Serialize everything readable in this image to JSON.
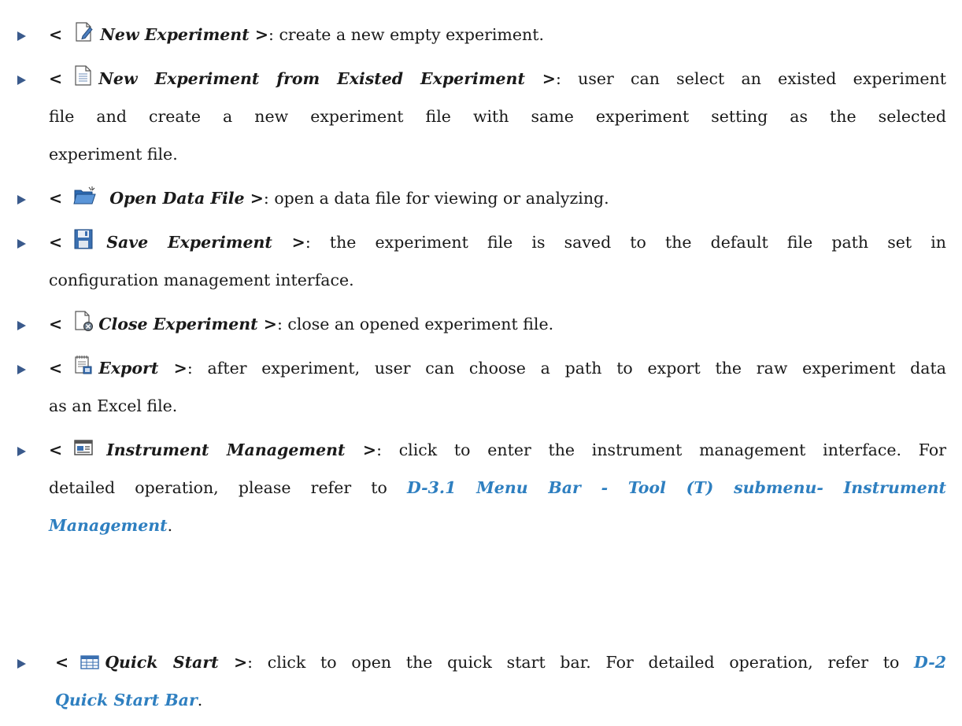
{
  "colors": {
    "bullet": "#3a5a8c",
    "link": "#2e7fc0",
    "text": "#1a1a1a"
  },
  "items": [
    {
      "icon": "new-document-pencil-icon",
      "lt": "<",
      "name": "New Experiment",
      "gt": " >",
      "lines": [
        ": create a new empty experiment."
      ]
    },
    {
      "icon": "document-lines-icon",
      "lt": "<",
      "name": "New Experiment from Existed Experiment",
      "gt": " >",
      "lines": [
        ": user can select an existed experiment",
        "file and create a new experiment file with same experiment setting as the selected",
        "experiment file."
      ]
    },
    {
      "icon": "open-folder-icon",
      "lt": "<",
      "name": "Open Data File",
      "gt": " >",
      "lines": [
        ": open a data file for viewing or analyzing."
      ]
    },
    {
      "icon": "floppy-save-icon",
      "lt": "<",
      "name": "Save Experiment",
      "gt": " >",
      "lines": [
        ": the experiment file is saved to the default file path set in",
        "configuration management interface."
      ]
    },
    {
      "icon": "close-document-icon",
      "lt": "<",
      "name": "Close Experiment",
      "gt": " >",
      "lines": [
        ": close an opened experiment file."
      ]
    },
    {
      "icon": "export-document-icon",
      "lt": "<",
      "name": "Export",
      "gt": " >",
      "lines": [
        ": after experiment, user can choose a path to export the raw experiment data",
        "as an Excel file."
      ]
    },
    {
      "icon": "instrument-window-icon",
      "lt": "<",
      "name": "Instrument Management",
      "gt": " >",
      "lines": [
        ": click to enter the instrument management interface. For",
        "detailed operation, please refer to ",
        "Management",
        "."
      ],
      "link": "D-3.1 Menu Bar - Tool (T) submenu- Instrument"
    },
    {
      "icon": "quick-start-grid-icon",
      "lt": "<",
      "name": "Quick Start",
      "gt": " >",
      "lines": [
        ": click to open the quick start bar. For detailed operation, refer to ",
        "D-2",
        "Quick Start Bar",
        "."
      ]
    }
  ]
}
